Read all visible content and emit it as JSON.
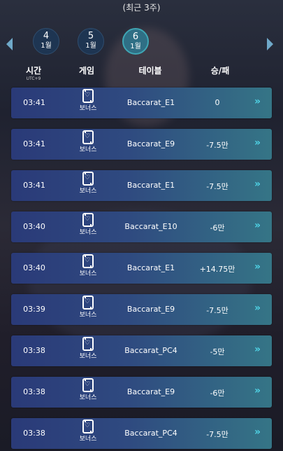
{
  "header": {
    "title": "(최근 3주)"
  },
  "weeks": [
    {
      "day": "4",
      "month": "1월",
      "active": false
    },
    {
      "day": "5",
      "month": "1월",
      "active": false
    },
    {
      "day": "6",
      "month": "1월",
      "active": true
    }
  ],
  "columns": {
    "time": "시간",
    "time_sub": "UTC+9",
    "game": "게임",
    "table": "테이블",
    "result": "승/패"
  },
  "rows": [
    {
      "time": "03:41",
      "game": "보너스",
      "table": "Baccarat_E1",
      "result": "0"
    },
    {
      "time": "03:41",
      "game": "보너스",
      "table": "Baccarat_E9",
      "result": "-7.5만"
    },
    {
      "time": "03:41",
      "game": "보너스",
      "table": "Baccarat_E1",
      "result": "-7.5만"
    },
    {
      "time": "03:40",
      "game": "보너스",
      "table": "Baccarat_E10",
      "result": "-6만"
    },
    {
      "time": "03:40",
      "game": "보너스",
      "table": "Baccarat_E1",
      "result": "+14.75만"
    },
    {
      "time": "03:39",
      "game": "보너스",
      "table": "Baccarat_E9",
      "result": "-7.5만"
    },
    {
      "time": "03:38",
      "game": "보너스",
      "table": "Baccarat_PC4",
      "result": "-5만"
    },
    {
      "time": "03:38",
      "game": "보너스",
      "table": "Baccarat_E9",
      "result": "-6만"
    },
    {
      "time": "03:38",
      "game": "보너스",
      "table": "Baccarat_PC4",
      "result": "-7.5만"
    }
  ],
  "icons": {
    "prev": "chevron-left-icon",
    "next": "chevron-right-icon",
    "game": "card-heart-icon",
    "detail": "double-chevron-right-icon"
  },
  "colors": {
    "accent": "#4fd3e6",
    "row_start": "#2a3a78",
    "row_end": "#357586",
    "active_day": "#2f6f85"
  }
}
